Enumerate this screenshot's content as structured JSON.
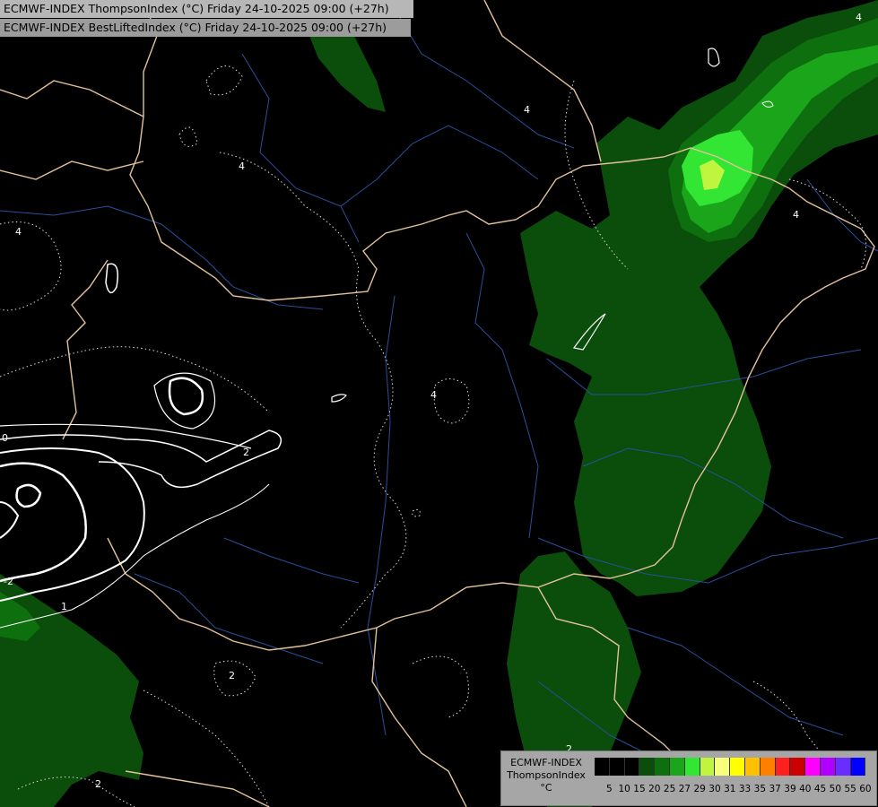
{
  "header": {
    "line1": "ECMWF-INDEX ThompsonIndex (°C) Friday 24-10-2025 09:00 (+27h)",
    "line2": "ECMWF-INDEX BestLiftedIndex (°C) Friday 24-10-2025 09:00 (+27h)"
  },
  "legend": {
    "model": "ECMWF-INDEX",
    "parameter": "ThompsonIndex",
    "unit": "°C",
    "levels": [
      "5",
      "10",
      "15",
      "20",
      "25",
      "27",
      "29",
      "30",
      "31",
      "33",
      "35",
      "37",
      "39",
      "40",
      "45",
      "50",
      "55",
      "60"
    ],
    "colors": [
      "#000000",
      "#000000",
      "#000000",
      "#0b4d0b",
      "#0e6f0e",
      "#1aa51a",
      "#33e633",
      "#bff53f",
      "#f8ff7a",
      "#ffff00",
      "#ffc000",
      "#ff8000",
      "#ff2020",
      "#cc0000",
      "#ff00ff",
      "#b000ff",
      "#6a2dff",
      "#0000ff"
    ]
  },
  "contour_labels": [
    "4",
    "4",
    "4",
    "4",
    "4",
    "4",
    "2",
    "2",
    "2",
    "2",
    "0",
    "-2",
    "1"
  ]
}
